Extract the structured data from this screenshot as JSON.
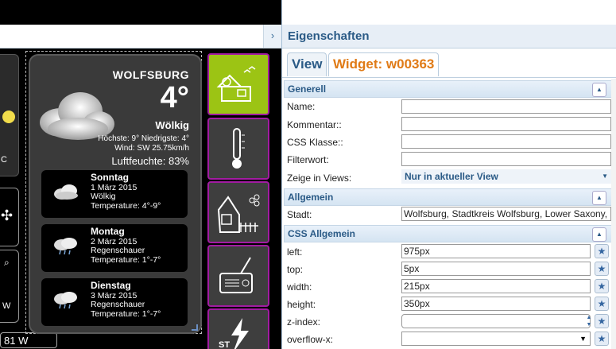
{
  "panel": {
    "title": "Eigenschaften",
    "collapse_icon": "›",
    "tabs": [
      {
        "label": "View"
      },
      {
        "label": "Widget: w00363"
      }
    ]
  },
  "sections": {
    "generell": {
      "title": "Generell",
      "fields": {
        "name": {
          "label": "Name:",
          "value": ""
        },
        "kommentar": {
          "label": "Kommentar::",
          "value": ""
        },
        "css_klasse": {
          "label": "CSS Klasse::",
          "value": ""
        },
        "filterwort": {
          "label": "Filterwort:",
          "value": ""
        },
        "views": {
          "label": "Zeige in Views:",
          "value": "Nur in aktueller View"
        }
      }
    },
    "allgemein": {
      "title": "Allgemein",
      "stadt": {
        "label": "Stadt:",
        "value": "Wolfsburg, Stadtkreis Wolfsburg, Lower Saxony,"
      }
    },
    "css": {
      "title": "CSS Allgemein",
      "left": {
        "label": "left:",
        "value": "975px"
      },
      "top": {
        "label": "top:",
        "value": "5px"
      },
      "width": {
        "label": "width:",
        "value": "215px"
      },
      "height": {
        "label": "height:",
        "value": "350px"
      },
      "z_index": {
        "label": "z-index:",
        "value": ""
      },
      "overflow_x": {
        "label": "overflow-x:",
        "value": ""
      }
    }
  },
  "weather": {
    "city": "WOLFSBURG",
    "temp": "4°",
    "condition": "Wölkig",
    "hilo": "Höchste: 9° Niedrigste: 4°",
    "wind": "Wind: SW 25.75km/h",
    "humidity": "Luftfeuchte: 83%",
    "forecast": [
      {
        "day": "Sonntag",
        "date": "1 März 2015",
        "cond": "Wölkig",
        "temp": "Temperature: 4°-9°"
      },
      {
        "day": "Montag",
        "date": "2 März 2015",
        "cond": "Regenschauer",
        "temp": "Temperature: 1°-7°"
      },
      {
        "day": "Dienstag",
        "date": "3 März 2015",
        "cond": "Regenschauer",
        "temp": "Temperature: 1°-7°"
      }
    ]
  },
  "canvas": {
    "status_bottom": "81 W",
    "partial_letter": "W",
    "partial_c": "C",
    "side_btn_label": "ST"
  },
  "colors": {
    "accent": "#e07b17",
    "brand": "#2a5a86",
    "active_tile": "#9cc414",
    "border": "#a21ca2"
  }
}
